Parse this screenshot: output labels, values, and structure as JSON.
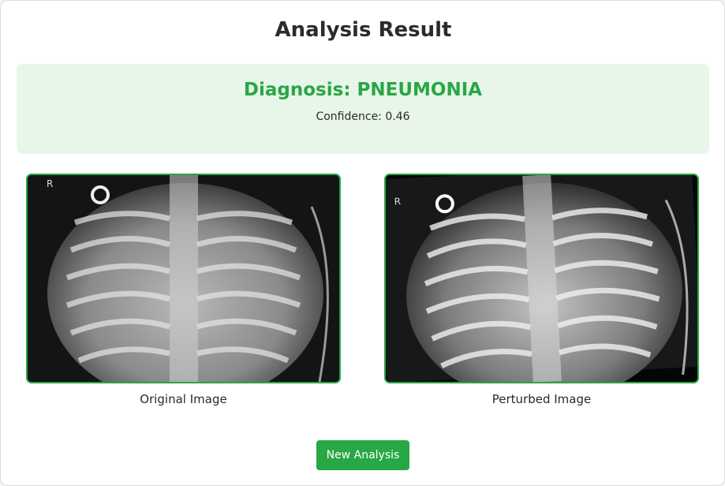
{
  "page": {
    "title": "Analysis Result"
  },
  "result": {
    "diagnosis": "Diagnosis: PNEUMONIA",
    "confidence": "Confidence: 0.46"
  },
  "images": [
    {
      "caption": "Original Image",
      "marker": "R"
    },
    {
      "caption": "Perturbed Image",
      "marker": "R"
    }
  ],
  "actions": {
    "new_analysis_label": "New Analysis"
  },
  "colors": {
    "accent": "#28a745",
    "result_bg": "#e8f5e9"
  }
}
